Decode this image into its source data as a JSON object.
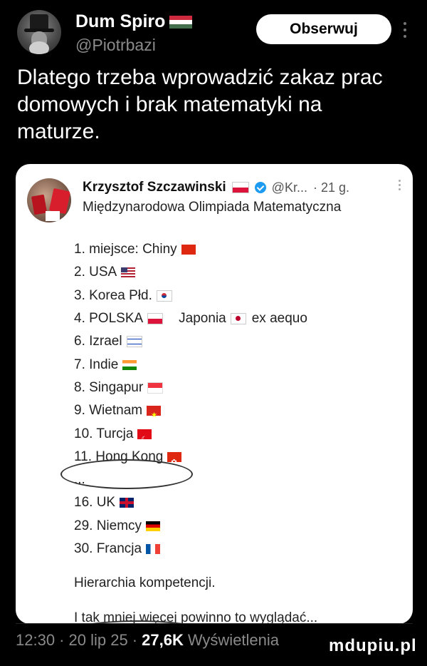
{
  "author": {
    "name": "Dum Spiro",
    "handle": "@Piotrbazi",
    "flag_icon": "hungary-flag-icon",
    "follow_label": "Obserwuj"
  },
  "tweet": {
    "text": "Dlatego trzeba wprowadzić zakaz prac domowych i brak matematyki na maturze."
  },
  "quoted": {
    "name": "Krzysztof Szczawinski",
    "handle": "@Kr...",
    "time": "· 21 g.",
    "subtitle": "Międzynarodowa Olimpiada Matematyczna",
    "rankings": [
      {
        "label": "1. miejsce: Chiny",
        "flag": "china-flag-icon"
      },
      {
        "label": "2. USA",
        "flag": "usa-flag-icon"
      },
      {
        "label": "3. Korea Płd.",
        "flag": "south-korea-flag-icon"
      },
      {
        "label": "4. POLSKA",
        "flag": "poland-flag-icon",
        "extra": "Japonia",
        "extra_flag": "japan-flag-icon",
        "extra_text": "ex aequo"
      },
      {
        "label": "6. Izrael",
        "flag": "israel-flag-icon"
      },
      {
        "label": "7. Indie",
        "flag": "india-flag-icon"
      },
      {
        "label": "8. Singapur",
        "flag": "singapore-flag-icon"
      },
      {
        "label": "9. Wietnam",
        "flag": "vietnam-flag-icon"
      },
      {
        "label": "10. Turcja",
        "flag": "turkey-flag-icon"
      },
      {
        "label": "11. Hong Kong",
        "flag": "hong-kong-flag-icon"
      },
      {
        "label": "...",
        "flag": ""
      },
      {
        "label": "16. UK",
        "flag": "uk-flag-icon"
      },
      {
        "label": "29. Niemcy",
        "flag": "germany-flag-icon"
      },
      {
        "label": "30. Francja",
        "flag": "france-flag-icon"
      }
    ],
    "closing1": "Hierarchia kompetencji.",
    "closing2": "I tak mniej więcej powinno to wyglądać..."
  },
  "footer": {
    "time": "12:30",
    "date": "· 20 lip 25 ·",
    "views_count": "27,6K",
    "views_label": "Wyświetlenia"
  },
  "watermark": "mdupiu.pl"
}
